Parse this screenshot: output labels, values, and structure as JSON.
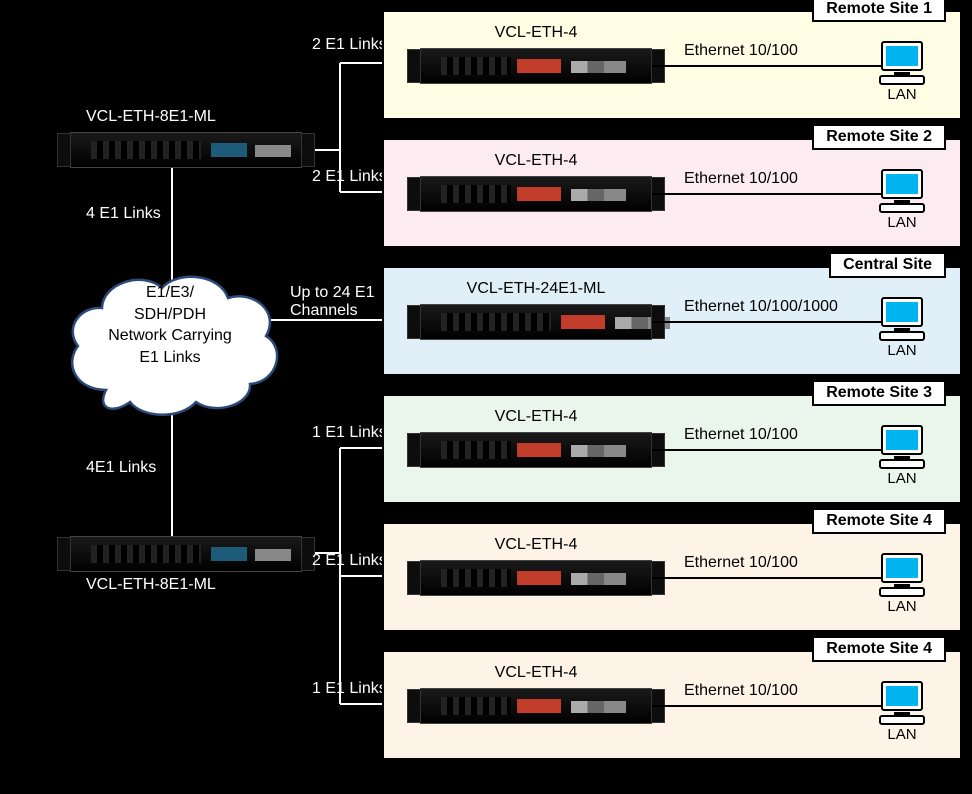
{
  "cloud_text": "E1/E3/\nSDH/PDH\nNetwork Carrying\nE1 Links",
  "left_devices": [
    {
      "label": "VCL-ETH-8E1-ML",
      "branch_a": "2 E1 Links",
      "branch_b": "2 E1 Links",
      "trunk": "4 E1 Links"
    },
    {
      "label": "VCL-ETH-8E1-ML",
      "branch_a": "1 E1 Links",
      "branch_b": "2 E1 Links",
      "branch_c": "1 E1 Links",
      "trunk": "4E1 Links"
    }
  ],
  "central_uplink": "Up to 24 E1\nChannels",
  "sites": [
    {
      "title": "Remote Site 1",
      "device": "VCL-ETH-4",
      "eth": "Ethernet 10/100",
      "lan": "LAN"
    },
    {
      "title": "Remote Site 2",
      "device": "VCL-ETH-4",
      "eth": "Ethernet 10/100",
      "lan": "LAN"
    },
    {
      "title": "Central Site",
      "device": "VCL-ETH-24E1-ML",
      "eth": "Ethernet 10/100/1000",
      "lan": "LAN"
    },
    {
      "title": "Remote Site 3",
      "device": "VCL-ETH-4",
      "eth": "Ethernet 10/100",
      "lan": "LAN"
    },
    {
      "title": "Remote Site 4",
      "device": "VCL-ETH-4",
      "eth": "Ethernet 10/100",
      "lan": "LAN"
    },
    {
      "title": "Remote Site 4",
      "device": "VCL-ETH-4",
      "eth": "Ethernet 10/100",
      "lan": "LAN"
    }
  ]
}
